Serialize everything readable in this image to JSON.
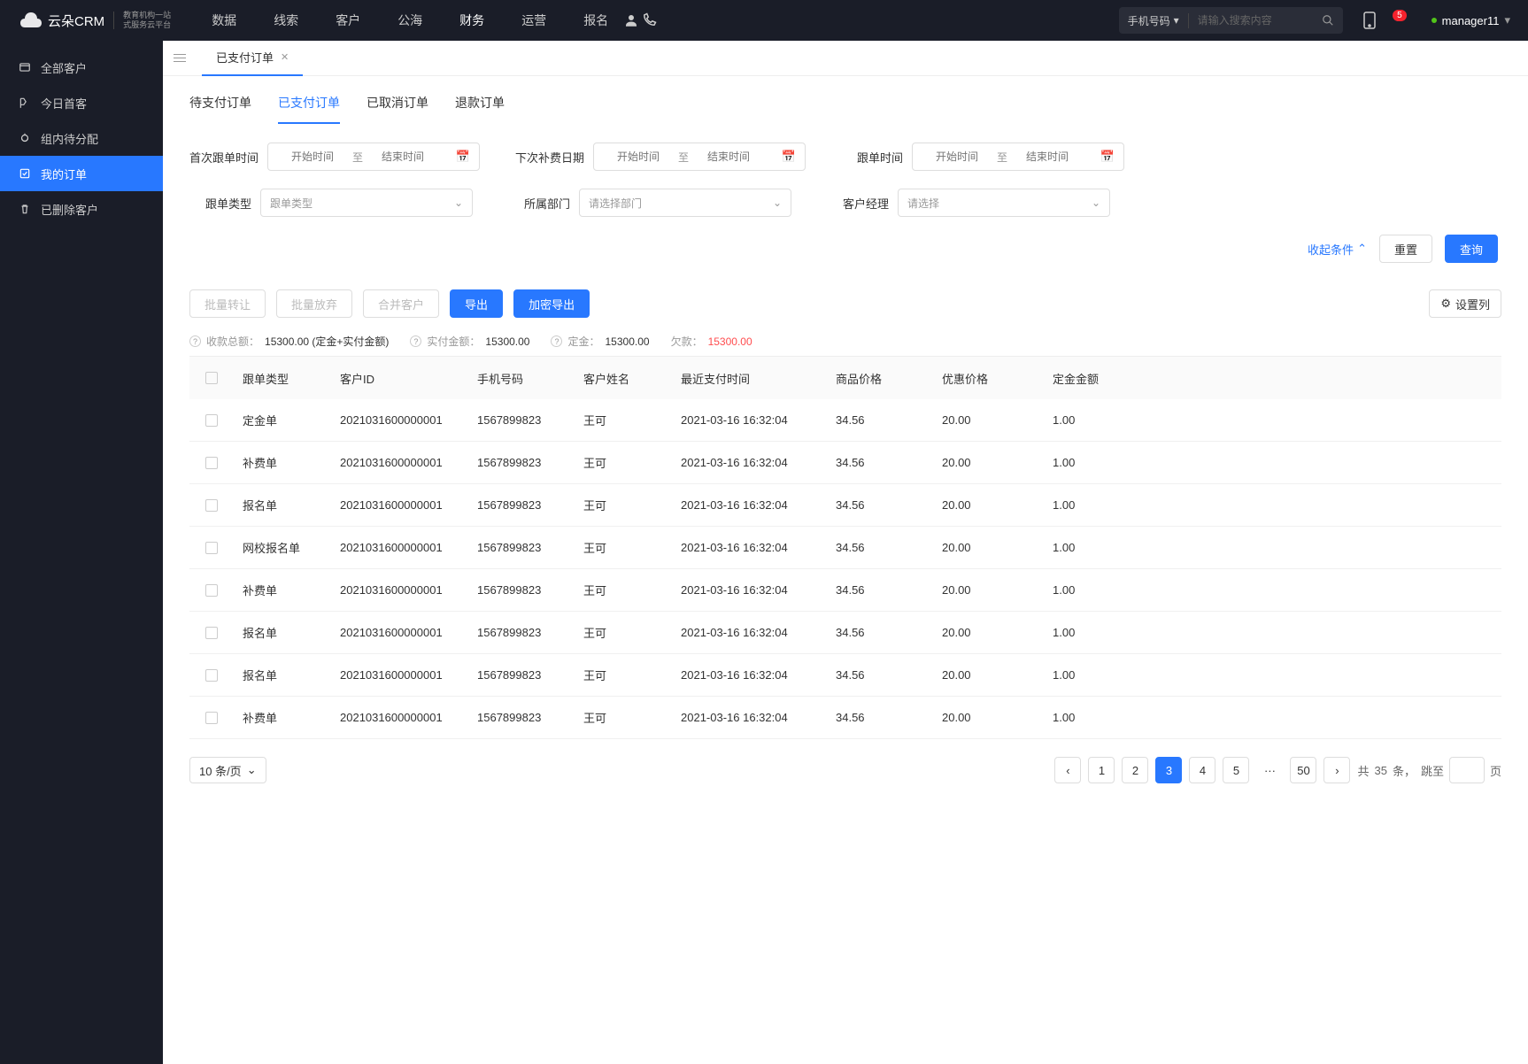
{
  "logo": {
    "brand": "云朵CRM",
    "sub1": "教育机构一站",
    "sub2": "式服务云平台"
  },
  "nav": {
    "items": [
      "数据",
      "线索",
      "客户",
      "公海",
      "财务",
      "运营",
      "报名"
    ],
    "active": 4
  },
  "search": {
    "type": "手机号码",
    "placeholder": "请输入搜索内容"
  },
  "notification_count": "5",
  "user": {
    "name": "manager11"
  },
  "sidebar": {
    "items": [
      {
        "label": "全部客户"
      },
      {
        "label": "今日首客"
      },
      {
        "label": "组内待分配"
      },
      {
        "label": "我的订单"
      },
      {
        "label": "已删除客户"
      }
    ],
    "active": 3
  },
  "tab": {
    "title": "已支付订单"
  },
  "sub_tabs": {
    "items": [
      "待支付订单",
      "已支付订单",
      "已取消订单",
      "退款订单"
    ],
    "active": 1
  },
  "filters": {
    "first_follow_label": "首次跟单时间",
    "start_ph": "开始时间",
    "to": "至",
    "end_ph": "结束时间",
    "next_fee_label": "下次补费日期",
    "follow_time_label": "跟单时间",
    "follow_type_label": "跟单类型",
    "follow_type_ph": "跟单类型",
    "dept_label": "所属部门",
    "dept_ph": "请选择部门",
    "manager_label": "客户经理",
    "manager_ph": "请选择",
    "collapse": "收起条件",
    "reset": "重置",
    "query": "查询"
  },
  "toolbar": {
    "batch_transfer": "批量转让",
    "batch_abandon": "批量放弃",
    "merge_customer": "合并客户",
    "export": "导出",
    "encrypt_export": "加密导出",
    "settings": "设置列"
  },
  "summary": {
    "total_label": "收款总额：",
    "total_val": "15300.00 (定金+实付金额)",
    "paid_label": "实付金额：",
    "paid_val": "15300.00",
    "deposit_label": "定金：",
    "deposit_val": "15300.00",
    "owed_label": "欠款：",
    "owed_val": "15300.00"
  },
  "table": {
    "headers": [
      "跟单类型",
      "客户ID",
      "手机号码",
      "客户姓名",
      "最近支付时间",
      "商品价格",
      "优惠价格",
      "定金金额"
    ],
    "rows": [
      {
        "type": "定金单",
        "id": "2021031600000001",
        "phone": "1567899823",
        "name": "王可",
        "time": "2021-03-16 16:32:04",
        "price": "34.56",
        "discount": "20.00",
        "deposit": "1.00"
      },
      {
        "type": "补费单",
        "id": "2021031600000001",
        "phone": "1567899823",
        "name": "王可",
        "time": "2021-03-16 16:32:04",
        "price": "34.56",
        "discount": "20.00",
        "deposit": "1.00"
      },
      {
        "type": "报名单",
        "id": "2021031600000001",
        "phone": "1567899823",
        "name": "王可",
        "time": "2021-03-16 16:32:04",
        "price": "34.56",
        "discount": "20.00",
        "deposit": "1.00"
      },
      {
        "type": "网校报名单",
        "id": "2021031600000001",
        "phone": "1567899823",
        "name": "王可",
        "time": "2021-03-16 16:32:04",
        "price": "34.56",
        "discount": "20.00",
        "deposit": "1.00"
      },
      {
        "type": "补费单",
        "id": "2021031600000001",
        "phone": "1567899823",
        "name": "王可",
        "time": "2021-03-16 16:32:04",
        "price": "34.56",
        "discount": "20.00",
        "deposit": "1.00"
      },
      {
        "type": "报名单",
        "id": "2021031600000001",
        "phone": "1567899823",
        "name": "王可",
        "time": "2021-03-16 16:32:04",
        "price": "34.56",
        "discount": "20.00",
        "deposit": "1.00"
      },
      {
        "type": "报名单",
        "id": "2021031600000001",
        "phone": "1567899823",
        "name": "王可",
        "time": "2021-03-16 16:32:04",
        "price": "34.56",
        "discount": "20.00",
        "deposit": "1.00"
      },
      {
        "type": "补费单",
        "id": "2021031600000001",
        "phone": "1567899823",
        "name": "王可",
        "time": "2021-03-16 16:32:04",
        "price": "34.56",
        "discount": "20.00",
        "deposit": "1.00"
      }
    ]
  },
  "pagination": {
    "page_size": "10 条/页",
    "pages": [
      "1",
      "2",
      "3",
      "4",
      "5"
    ],
    "ellipsis": "···",
    "last": "50",
    "active": 2,
    "total_prefix": "共 ",
    "total": "35",
    "total_suffix": " 条，",
    "jump_prefix": "跳至",
    "jump_suffix": "页"
  }
}
